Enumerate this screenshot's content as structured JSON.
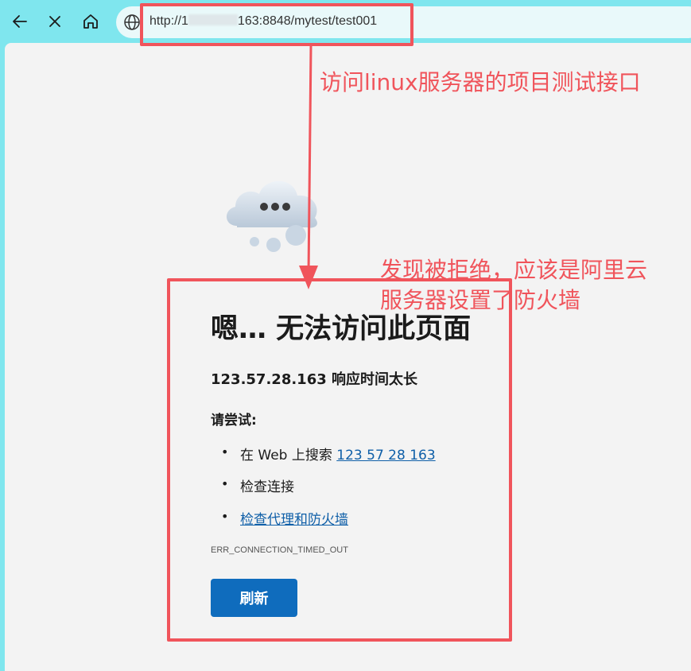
{
  "browser": {
    "url_prefix": "http://1",
    "url_suffix": "163:8848/mytest/test001"
  },
  "error_page": {
    "title": "嗯… 无法访问此页面",
    "subtitle": "123.57.28.163 响应时间太长",
    "try_label": "请尝试:",
    "suggestions": [
      {
        "prefix": "在 Web 上搜索 ",
        "link": "123 57 28 163"
      },
      {
        "text": "检查连接"
      },
      {
        "link": "检查代理和防火墙"
      }
    ],
    "error_code": "ERR_CONNECTION_TIMED_OUT",
    "refresh_label": "刷新"
  },
  "annotations": {
    "note1": "访问linux服务器的项目测试接口",
    "note2_line1": "发现被拒绝，应该是阿里云",
    "note2_line2": "服务器设置了防火墙",
    "color": "#f0545b"
  }
}
